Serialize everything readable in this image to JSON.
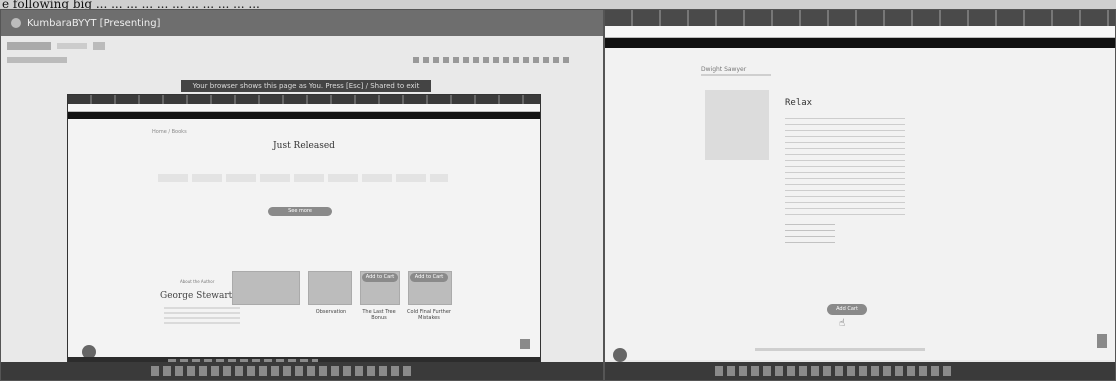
{
  "caption": {
    "text": "e following big ... ... ... ... ... ... ... ... ... ... ..."
  },
  "left": {
    "meet_title": "KumbaraBYYT [Presenting]",
    "banner_text": "Your browser shows this page as You. Press [Esc] / Shared to exit",
    "page_heading": "Just Released",
    "page_crumb": "Home / Books",
    "cta_button": "See more",
    "author_small": "About the Author",
    "author_name": "George Stewart",
    "book_buttons": [
      "Add to Cart",
      "Add to Cart"
    ],
    "book_labels": [
      "Observation",
      "The Last Tree Bonus",
      "Cold Final Further Mistakes"
    ]
  },
  "right": {
    "header_small": "Dwight Sawyer",
    "book_title": "Relax",
    "cta_button": "Add Cart"
  }
}
